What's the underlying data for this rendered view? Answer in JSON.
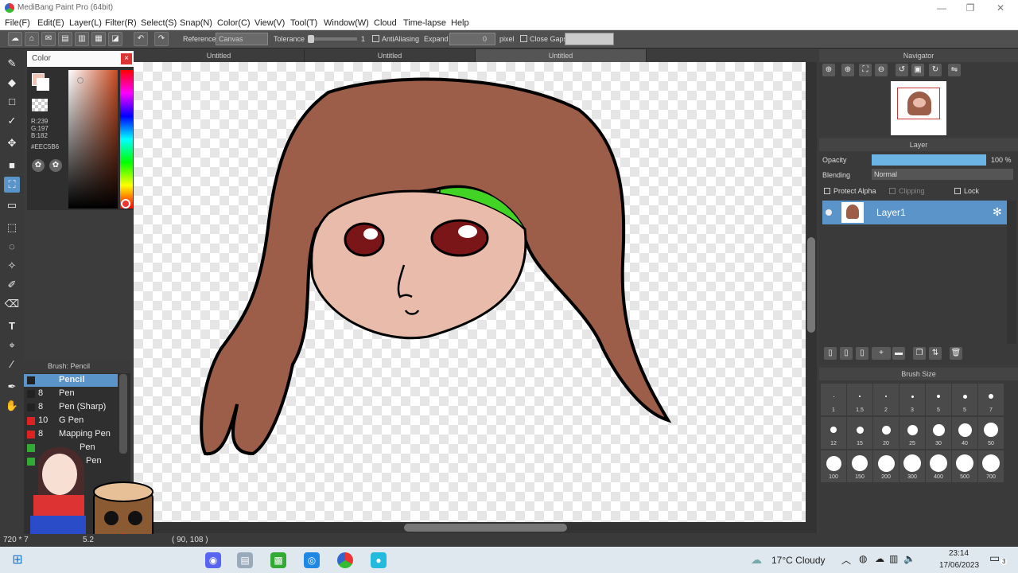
{
  "window": {
    "title": "MediBang Paint Pro (64bit)",
    "minimize": "—",
    "maximize": "❐",
    "close": "✕"
  },
  "menu": [
    "File(F)",
    "Edit(E)",
    "Layer(L)",
    "Filter(R)",
    "Select(S)",
    "Snap(N)",
    "Color(C)",
    "View(V)",
    "Tool(T)",
    "Window(W)",
    "Cloud",
    "Time-lapse",
    "Help"
  ],
  "toolbar": {
    "reference_label": "Reference",
    "reference_value": "Canvas",
    "tolerance_label": "Tolerance",
    "tolerance_value": "1",
    "antialiasing_label": "AntiAliasing",
    "expand_label": "Expand",
    "expand_value": "0",
    "expand_unit": "pixel",
    "close_gaps_label": "Close Gaps"
  },
  "color_panel": {
    "title": "Color",
    "r": "R:239",
    "g": "G:197",
    "b": "B:182",
    "hex": "#EEC5B6",
    "fg_color": "#eec5b6"
  },
  "tabs": [
    "Untitled",
    "Untitled",
    "Untitled"
  ],
  "brush_panel": {
    "title": "Brush: Pencil",
    "items": [
      {
        "size": "",
        "name": "Pencil",
        "color": "#222"
      },
      {
        "size": "8",
        "name": "Pen",
        "color": "#222"
      },
      {
        "size": "8",
        "name": "Pen (Sharp)",
        "color": "#222"
      },
      {
        "size": "10",
        "name": "G Pen",
        "color": "#d22"
      },
      {
        "size": "8",
        "name": "Mapping Pen",
        "color": "#d22"
      },
      {
        "size": "",
        "name": "Pen",
        "color": "#3a3"
      },
      {
        "size": "",
        "name": "Pen",
        "color": "#3a3"
      }
    ]
  },
  "navigator": {
    "title": "Navigator"
  },
  "layer_panel": {
    "title": "Layer",
    "opacity_label": "Opacity",
    "opacity_value": "100 %",
    "opacity_fraction": 1.0,
    "blending_label": "Blending",
    "blending_value": "Normal",
    "protect_alpha": "Protect Alpha",
    "clipping": "Clipping",
    "lock": "Lock",
    "layer_name": "Layer1"
  },
  "brush_size": {
    "title": "Brush Size",
    "sizes": [
      "1",
      "1.5",
      "2",
      "3",
      "5",
      "5",
      "7",
      "12",
      "15",
      "20",
      "25",
      "30",
      "40",
      "50",
      "100",
      "150",
      "200",
      "300",
      "400",
      "500",
      "700"
    ]
  },
  "status": {
    "size": "720 * 7",
    "zoom": "5.2",
    "coords": "( 90, 108 )"
  },
  "taskbar": {
    "weather": "17°C  Cloudy",
    "time": "23:14",
    "date": "17/06/2023",
    "notifications": "3"
  }
}
